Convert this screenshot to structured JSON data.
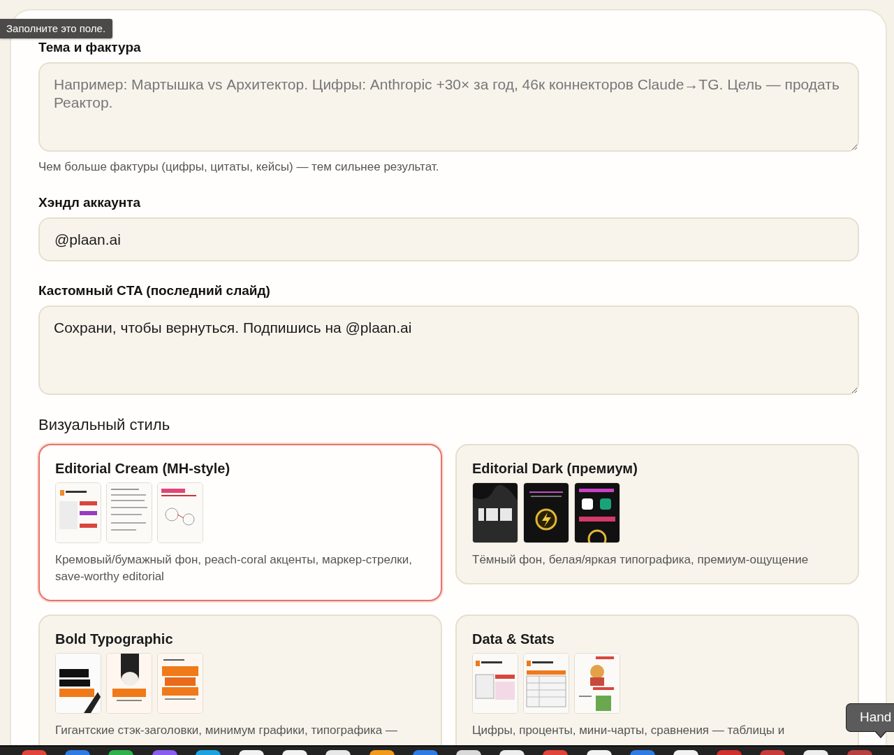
{
  "tooltip": {
    "text": "Заполните это поле."
  },
  "fields": [
    {
      "kind": "textarea",
      "label": "Тема и фактура",
      "placeholder": "Например: Мартышка vs Архитектор. Цифры: Anthropic +30× за год, 46к коннекторов Claude→TG. Цель — продать Реактор.",
      "hint": "Чем больше фактуры (цифры, цитаты, кейсы) — тем сильнее результат."
    },
    {
      "kind": "input",
      "label": "Хэндл аккаунта",
      "value": "@plaan.ai"
    },
    {
      "kind": "textarea",
      "label": "Кастомный CTA (последний слайд)",
      "value": "Сохрани, чтобы вернуться. Подпишись на @plaan.ai"
    }
  ],
  "visual_style": {
    "heading": "Визуальный стиль",
    "cards": [
      {
        "title": "Editorial Cream (MH-style)",
        "selected": true,
        "description": "Кремовый/бумажный фон, peach-coral акценты, маркер-стрелки, save-worthy editorial"
      },
      {
        "title": "Editorial Dark (премиум)",
        "selected": false,
        "description": "Тёмный фон, белая/яркая типографика, премиум-ощущение"
      },
      {
        "title": "Bold Typographic",
        "selected": false,
        "description": "Гигантские стэк-заголовки, минимум графики, типографика —"
      },
      {
        "title": "Data & Stats",
        "selected": false,
        "description": "Цифры, проценты, мини-чарты, сравнения — таблицы и"
      }
    ]
  },
  "hover_tooltip": {
    "text": "Hand"
  }
}
